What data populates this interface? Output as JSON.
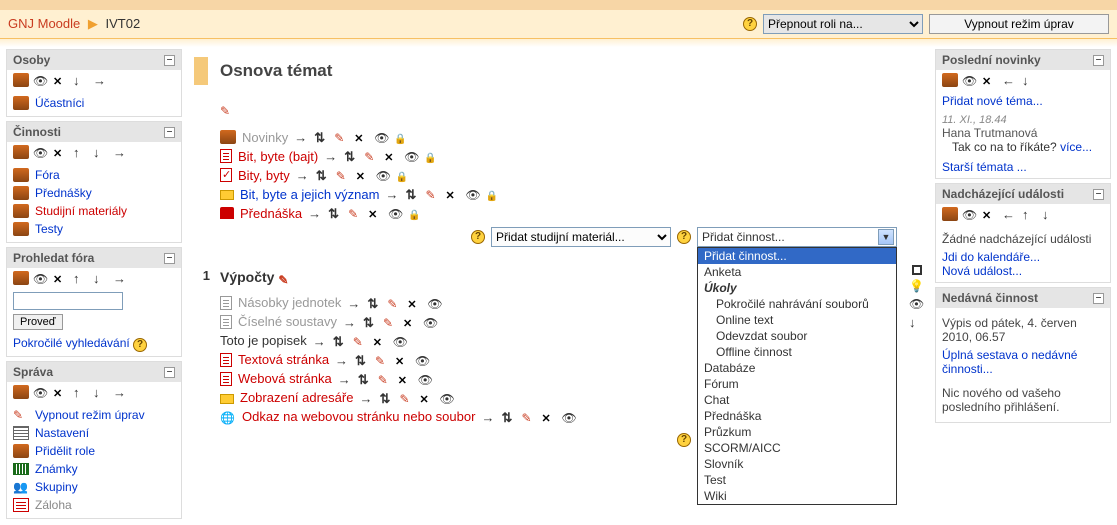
{
  "breadcrumb": {
    "site": "GNJ Moodle",
    "course": "IVT02"
  },
  "navbar": {
    "role_switch_placeholder": "Přepnout roli na...",
    "edit_off_button": "Vypnout režim úprav"
  },
  "blocks": {
    "osoby": {
      "title": "Osoby",
      "items": [
        {
          "label": "Účastníci"
        }
      ]
    },
    "cinnosti": {
      "title": "Činnosti",
      "items": [
        {
          "label": "Fóra"
        },
        {
          "label": "Přednášky"
        },
        {
          "label": "Studijní materiály",
          "red": true
        },
        {
          "label": "Testy"
        }
      ]
    },
    "search": {
      "title": "Prohledat fóra",
      "btn": "Proveď",
      "adv": "Pokročilé vyhledávání"
    },
    "admin": {
      "title": "Správa",
      "items": [
        {
          "label": "Vypnout režim úprav",
          "icon": "edit"
        },
        {
          "label": "Nastavení",
          "icon": "settings"
        },
        {
          "label": "Přidělit role",
          "icon": "group"
        },
        {
          "label": "Známky",
          "icon": "grid"
        },
        {
          "label": "Skupiny",
          "icon": "users"
        },
        {
          "label": "Záloha",
          "icon": "doc",
          "grey": true
        }
      ]
    },
    "news": {
      "title": "Poslední novinky",
      "add": "Přidat nové téma...",
      "post": {
        "date": "11. XI., 18.44",
        "author": "Hana Trutmanová",
        "text": "Tak co na to říkáte?",
        "more": "více..."
      },
      "older": "Starší témata ..."
    },
    "upcoming": {
      "title": "Nadcházející události",
      "none": "Žádné nadcházející události",
      "cal": "Jdi do kalendáře...",
      "newev": "Nová událost..."
    },
    "recent": {
      "title": "Nedávná činnost",
      "since": "Výpis od pátek, 4. červen 2010, 06.57",
      "full": "Úplná sestava o nedávné činnosti...",
      "nothing": "Nic nového od vašeho posledního přihlášení."
    }
  },
  "main": {
    "heading": "Osnova témat",
    "add_material_placeholder": "Přidat studijní materiál...",
    "add_activity_placeholder": "Přidat činnost...",
    "topic0": {
      "activities": [
        {
          "title": "Novinky",
          "style": "grey",
          "icon": "group"
        },
        {
          "title": "Bit, byte (bajt)",
          "style": "red",
          "icon": "doc"
        },
        {
          "title": "Bity, byty",
          "style": "red",
          "icon": "quiz"
        },
        {
          "title": "Bit, byte a jejich význam",
          "style": "link",
          "icon": "folder"
        },
        {
          "title": "Přednáška",
          "style": "red",
          "icon": "lect"
        }
      ]
    },
    "topic1": {
      "num": "1",
      "heading": "Výpočty",
      "desc_label": "Toto je popisek",
      "activities_a": [
        {
          "title": "Násobky jednotek",
          "style": "grey",
          "icon": "doc-grey"
        },
        {
          "title": "Číselné soustavy",
          "style": "grey",
          "icon": "doc-grey"
        }
      ],
      "activities_b": [
        {
          "title": "Textová stránka",
          "style": "red",
          "icon": "doc"
        },
        {
          "title": "Webová stránka",
          "style": "red",
          "icon": "doc"
        },
        {
          "title": "Zobrazení adresáře",
          "style": "red",
          "icon": "folder"
        },
        {
          "title": "Odkaz na webovou stránku nebo soubor",
          "style": "red",
          "icon": "globe"
        }
      ]
    },
    "activity_dropdown": {
      "selected": "Přidat činnost...",
      "options": [
        {
          "label": "Přidat činnost...",
          "selected": true
        },
        {
          "label": "Anketa"
        },
        {
          "label": "Úkoly",
          "bold": true
        },
        {
          "label": "Pokročilé nahrávání souborů",
          "indent": true
        },
        {
          "label": "Online text",
          "indent": true
        },
        {
          "label": "Odevzdat soubor",
          "indent": true
        },
        {
          "label": "Offline činnost",
          "indent": true
        },
        {
          "label": "Databáze"
        },
        {
          "label": "Fórum"
        },
        {
          "label": "Chat"
        },
        {
          "label": "Přednáška"
        },
        {
          "label": "Průzkum"
        },
        {
          "label": "SCORM/AICC"
        },
        {
          "label": "Slovník"
        },
        {
          "label": "Test"
        },
        {
          "label": "Wiki"
        }
      ]
    }
  }
}
